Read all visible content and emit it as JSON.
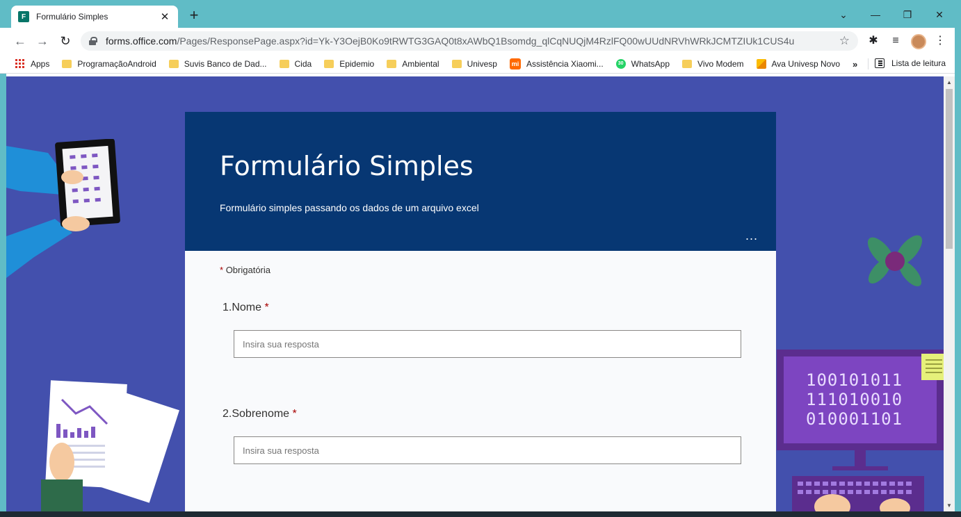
{
  "browser": {
    "tab_title": "Formulário Simples",
    "tab_favicon": "F",
    "url_host": "forms.office.com",
    "url_path": "/Pages/ResponsePage.aspx?id=Yk-Y3OejB0Ko9tRWTG3GAQ0t8xAWbQ1Bsomdg_qlCqNUQjM4RzlFQ00wUUdNRVhWRkJCMTZIUk1CUS4u",
    "bookmarks": [
      {
        "label": "Apps",
        "icon": "apps-grid-icon"
      },
      {
        "label": "ProgramaçãoAndroid",
        "icon": "folder-icon"
      },
      {
        "label": "Suvis Banco de Dad...",
        "icon": "folder-icon"
      },
      {
        "label": "Cida",
        "icon": "folder-icon"
      },
      {
        "label": "Epidemio",
        "icon": "folder-icon"
      },
      {
        "label": "Ambiental",
        "icon": "folder-icon"
      },
      {
        "label": "Univesp",
        "icon": "folder-icon"
      },
      {
        "label": "Assistência Xiaomi...",
        "icon": "xiaomi-icon"
      },
      {
        "label": "WhatsApp",
        "icon": "whatsapp-icon",
        "badge": "30"
      },
      {
        "label": "Vivo Modem",
        "icon": "folder-icon"
      },
      {
        "label": "Ava Univesp Novo",
        "icon": "pencil-icon"
      }
    ],
    "more_bookmarks": "»",
    "reading_list": "Lista de leitura"
  },
  "form": {
    "title": "Formulário Simples",
    "description": "Formulário simples passando os dados de um arquivo excel",
    "more": "...",
    "required_asterisk": "*",
    "required_note": "Obrigatória",
    "questions": [
      {
        "number": "1.",
        "label": "Nome",
        "placeholder": "Insira sua resposta"
      },
      {
        "number": "2.",
        "label": "Sobrenome",
        "placeholder": "Insira sua resposta"
      }
    ]
  },
  "decor": {
    "binary_lines": [
      "100101011",
      "111010010",
      "010001101"
    ]
  },
  "colors": {
    "chrome": "#60bcc6",
    "background": "#4350ad",
    "header": "#073773",
    "required": "#a80000"
  }
}
